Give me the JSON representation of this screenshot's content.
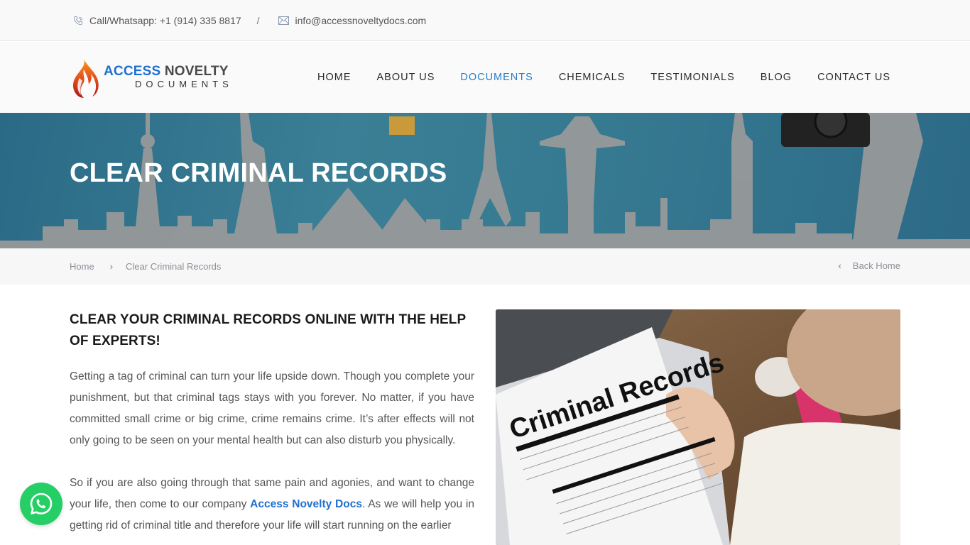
{
  "topbar": {
    "phone_label": "Call/Whatsapp: +1 (914) 335 8817",
    "separator": "/",
    "email": "info@accessnoveltydocs.com",
    "phone_icon": "phone-icon",
    "email_icon": "envelope-icon"
  },
  "logo": {
    "word1": "ACCESS",
    "word2": "NOVELTY",
    "word3": "DOCUMENTS",
    "icon": "flame-icon"
  },
  "nav": {
    "items": [
      {
        "label": "HOME",
        "active": false
      },
      {
        "label": "ABOUT US",
        "active": false
      },
      {
        "label": "DOCUMENTS",
        "active": true
      },
      {
        "label": "CHEMICALS",
        "active": false
      },
      {
        "label": "TESTIMONIALS",
        "active": false
      },
      {
        "label": "BLOG",
        "active": false
      },
      {
        "label": "CONTACT US",
        "active": false
      }
    ]
  },
  "hero": {
    "title": "CLEAR CRIMINAL RECORDS"
  },
  "breadcrumb": {
    "home": "Home",
    "separator": "›",
    "current": "Clear Criminal Records",
    "back_label": "Back Home",
    "back_icon": "‹"
  },
  "content": {
    "heading": "CLEAR YOUR CRIMINAL RECORDS ONLINE WITH THE HELP OF EXPERTS!",
    "paragraph1": "Getting a tag of criminal can turn your life upside down. Though you complete your punishment, but that criminal tags stays with you forever. No matter, if you have committed small crime or big crime, crime remains crime. It’s after effects will not only going to be seen on your mental health but can also disturb you physically.",
    "paragraph2_before": "So if you are also going through that same pain and agonies, and want to change your life, then come to our company ",
    "paragraph2_link": "Access Novelty Docs",
    "paragraph2_after": ". As we will help you in getting rid of criminal title and therefore your life will start running on the earlier",
    "image": {
      "headline": "Criminal Records",
      "alt": "Person holding a Criminal Records form"
    }
  },
  "colors": {
    "brand_blue": "#1e6fd0",
    "nav_active": "#2a7dc9",
    "whatsapp_green": "#26cf65",
    "hero_bg": "#367a91"
  },
  "whatsapp": {
    "icon": "whatsapp-icon"
  }
}
